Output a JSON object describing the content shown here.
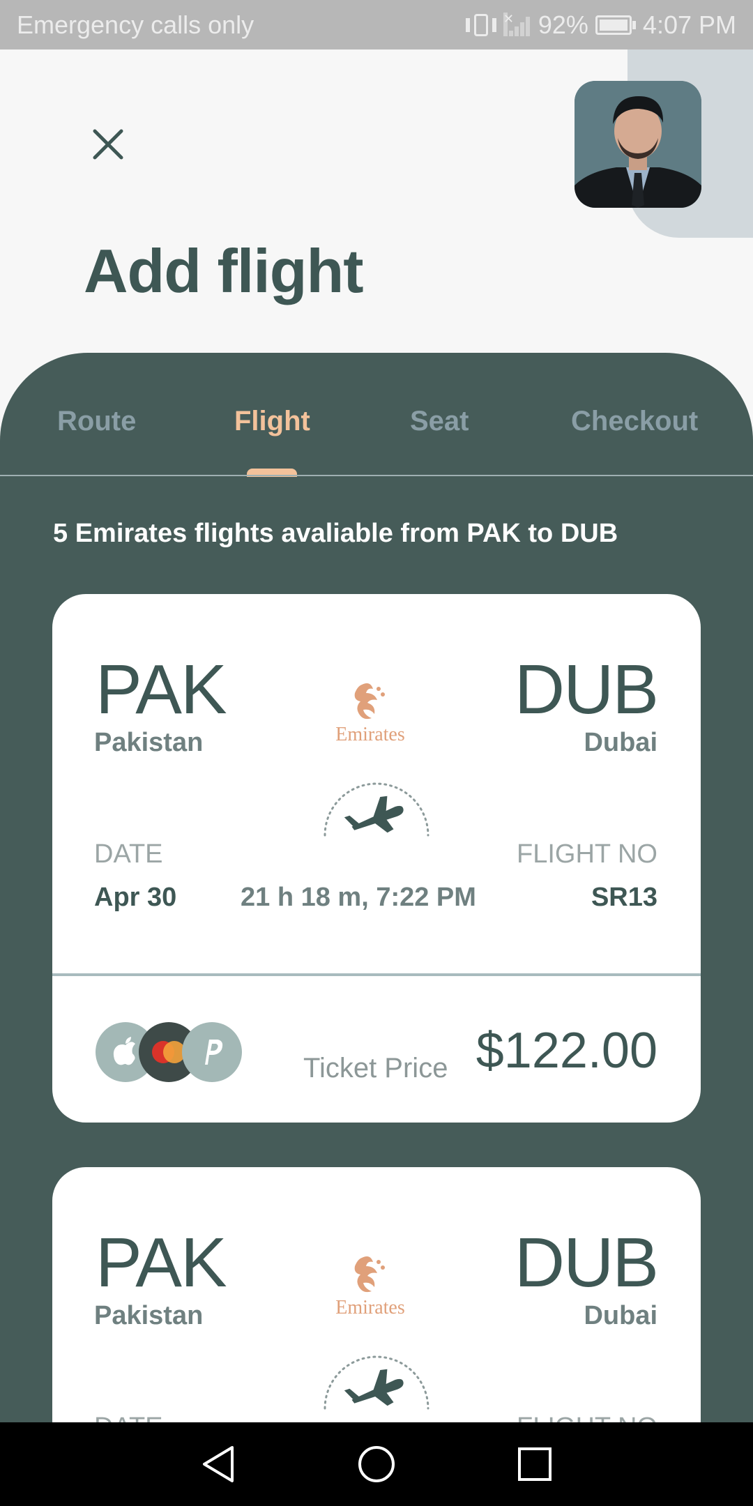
{
  "status_bar": {
    "carrier_text": "Emergency calls only",
    "battery": "92%",
    "time": "4:07 PM",
    "icons": [
      "vibrate-icon",
      "no-signal-icon",
      "battery-icon"
    ]
  },
  "header": {
    "close_icon": "close-icon",
    "title": "Add flight"
  },
  "tabs": [
    {
      "label": "Route",
      "active": false
    },
    {
      "label": "Flight",
      "active": true
    },
    {
      "label": "Seat",
      "active": false
    },
    {
      "label": "Checkout",
      "active": false
    }
  ],
  "summary": "5 Emirates flights avaliable from PAK to DUB",
  "flights": [
    {
      "from_code": "PAK",
      "from_city": "Pakistan",
      "to_code": "DUB",
      "to_city": "Dubai",
      "airline_logo": "Emirates",
      "date_label": "DATE",
      "date": "Apr 30",
      "duration": "21 h 18 m, 7:22 PM",
      "flight_no_label": "FLIGHT NO",
      "flight_no": "SR13",
      "price_label": "Ticket Price",
      "price": "$122.00",
      "payment_icons": [
        "apple-pay-icon",
        "mastercard-icon",
        "paypal-icon"
      ]
    },
    {
      "from_code": "PAK",
      "from_city": "Pakistan",
      "to_code": "DUB",
      "to_city": "Dubai",
      "airline_logo": "Emirates",
      "date_label": "DATE",
      "flight_no_label": "FLIGHT NO"
    }
  ],
  "colors": {
    "panel": "#465C59",
    "accent": "#F3C29B",
    "title": "#3E5754",
    "tab_inactive": "#8A9EA6"
  },
  "nav_bar": [
    "back-icon",
    "home-icon",
    "recents-icon"
  ]
}
